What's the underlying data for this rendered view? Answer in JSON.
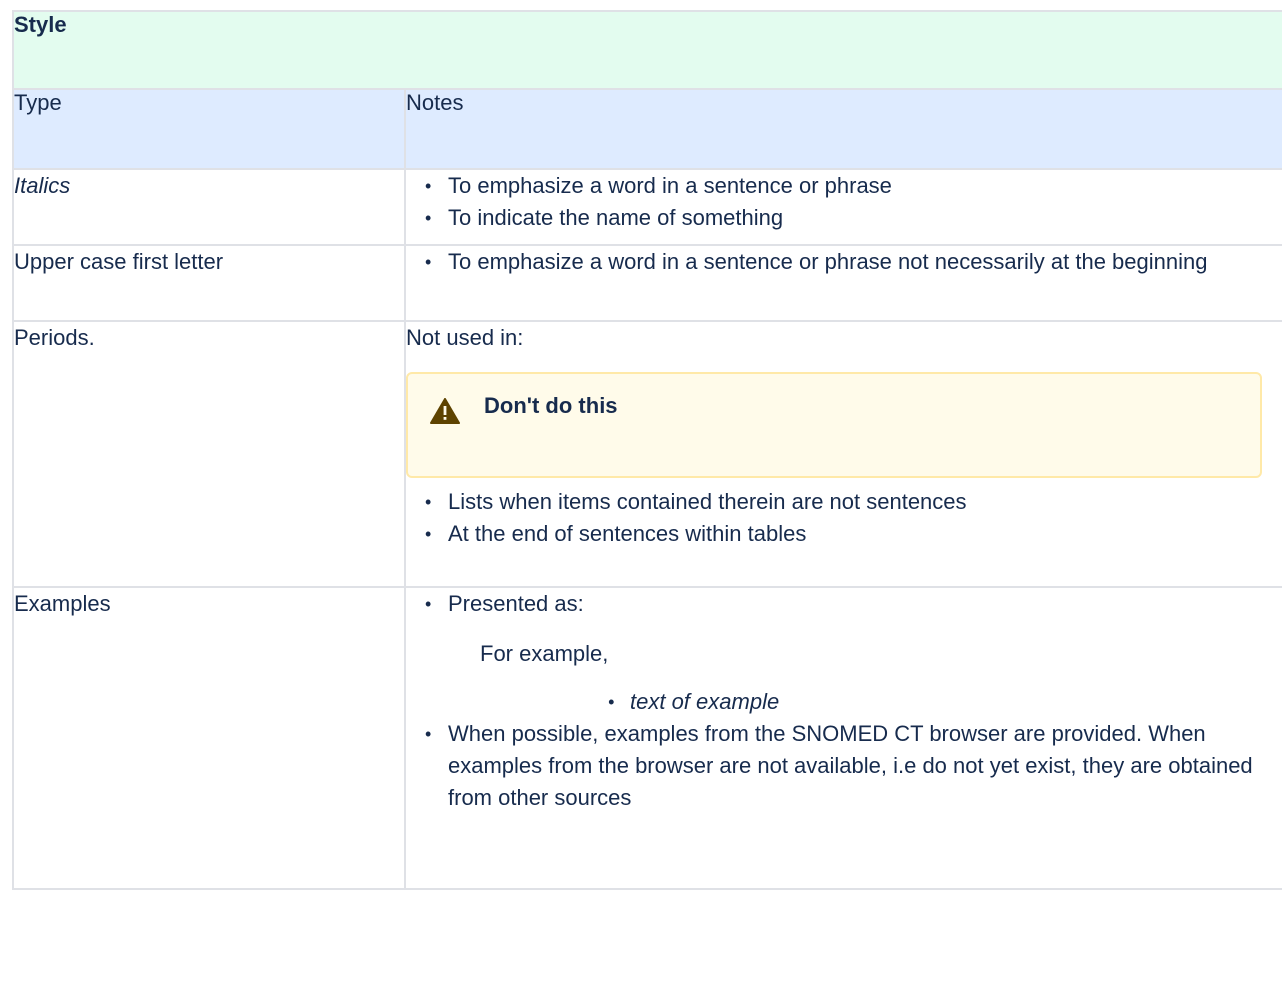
{
  "table": {
    "title": "Style",
    "headers": {
      "type": "Type",
      "notes": "Notes"
    },
    "rows": {
      "italics": {
        "type": "Italics",
        "notes": [
          "To emphasize a word in a sentence or phrase",
          "To indicate the name of something"
        ]
      },
      "upper": {
        "type": "Upper case first letter",
        "notes": [
          "To emphasize a word in a sentence or phrase not necessarily at the beginning"
        ]
      },
      "periods": {
        "type": "Periods.",
        "intro": "Not used in:",
        "warning": {
          "icon": "warning-icon",
          "title": "Don't do this",
          "border_color": "#ffe9a8",
          "background_color": "#fffbea"
        },
        "notes": [
          "Lists when items contained therein are not sentences",
          "At the end of sentences within tables"
        ]
      },
      "examples": {
        "type": "Examples",
        "presented_as": "Presented as:",
        "for_example": "For example,",
        "example_item": "text of example",
        "notes": [
          "When possible, examples from the SNOMED CT browser are provided. When examples from the browser are not available, i.e do not yet exist, they are obtained from other sources"
        ]
      }
    },
    "colors": {
      "title_background": "#e3fcef",
      "header_background": "#deebff",
      "border": "#dfe1e6"
    }
  }
}
